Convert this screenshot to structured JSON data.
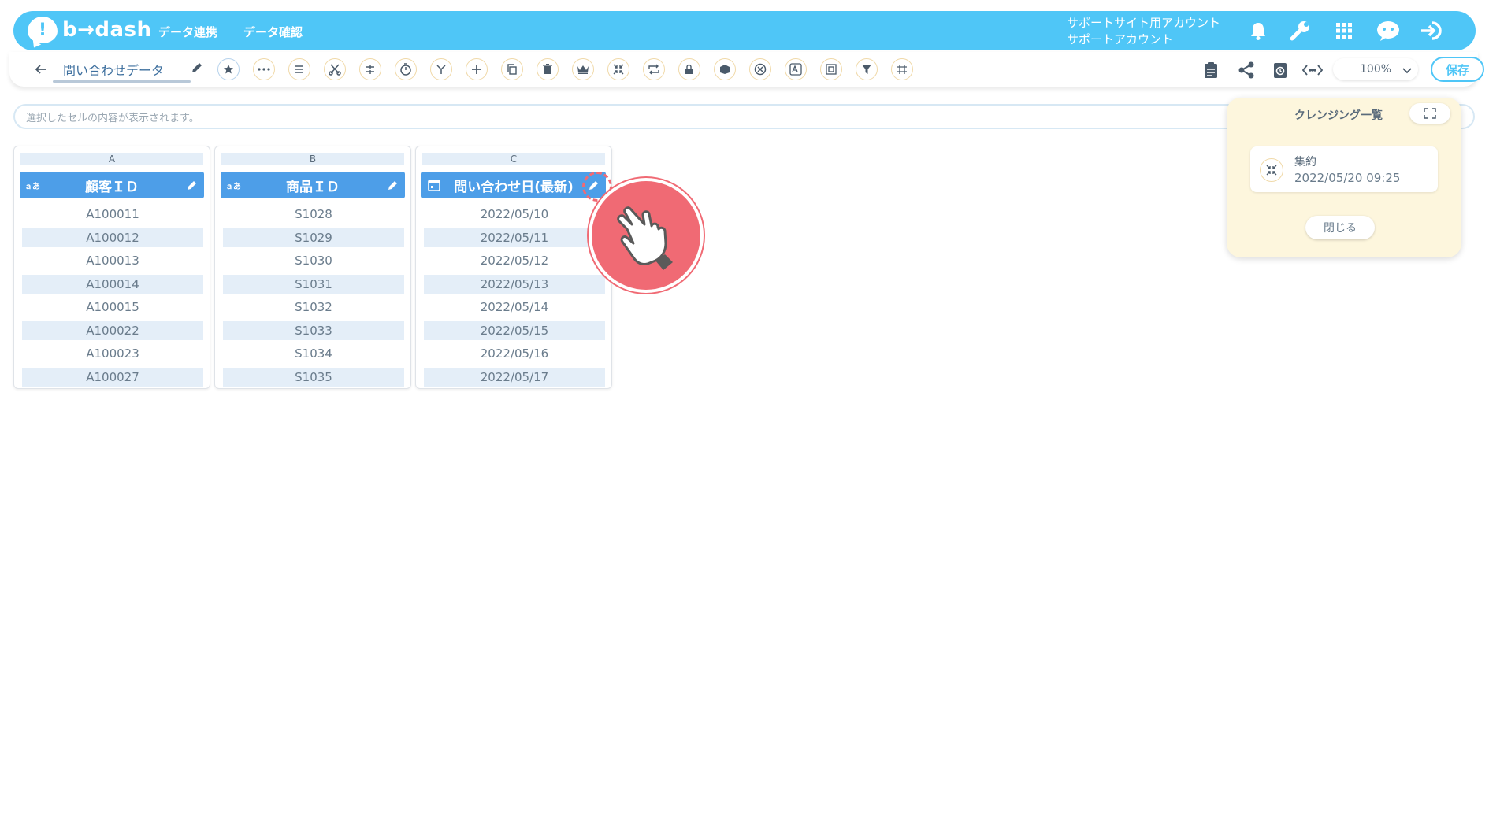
{
  "header": {
    "logo_text": "b→dash",
    "nav": [
      "データ連携",
      "データ確認"
    ],
    "account_line1": "サポートサイト用アカウント",
    "account_line2": "サポートアカウント",
    "icons": [
      "bell-icon",
      "wrench-icon",
      "apps-grid-icon",
      "chat-bot-icon",
      "logout-icon"
    ]
  },
  "toolbar": {
    "title": "問い合わせデータ",
    "zoom": "100%",
    "save_label": "保存",
    "tools": [
      "star-icon",
      "dots-icon",
      "list-icon",
      "scissors-icon",
      "sort-icon",
      "timer-icon",
      "branch-icon",
      "plus-icon",
      "copy-icon",
      "trash-icon",
      "crown-icon",
      "collapse-icon",
      "repeat-icon",
      "lock-icon",
      "box-icon",
      "cancel-icon",
      "translate-icon",
      "frame-icon",
      "filter-icon",
      "grid-icon"
    ],
    "right_tools": [
      "clipboard-icon",
      "share-icon",
      "history-icon",
      "code-icon"
    ]
  },
  "cellbar": {
    "placeholder": "選択したセルの内容が表示されます。"
  },
  "columns": [
    {
      "letter": "A",
      "name": "顧客ＩＤ",
      "type": "あ",
      "cells": [
        "A100011",
        "A100012",
        "A100013",
        "A100014",
        "A100015",
        "A100022",
        "A100023",
        "A100027"
      ]
    },
    {
      "letter": "B",
      "name": "商品ＩＤ",
      "type": "あ",
      "cells": [
        "S1028",
        "S1029",
        "S1030",
        "S1031",
        "S1032",
        "S1033",
        "S1034",
        "S1035"
      ]
    },
    {
      "letter": "C",
      "name": "問い合わせ日(最新)",
      "type": "calendar",
      "cells": [
        "2022/05/10",
        "2022/05/11",
        "2022/05/12",
        "2022/05/13",
        "2022/05/14",
        "2022/05/15",
        "2022/05/16",
        "2022/05/17"
      ]
    }
  ],
  "panel": {
    "title": "クレンジング一覧",
    "item_name": "集約",
    "item_date": "2022/05/20 09:25",
    "close_label": "閉じる"
  },
  "colors": {
    "header": "#4fc6f7",
    "column_header": "#4d9ee8",
    "highlight": "#f06a74",
    "panel_bg": "#fdf6dd"
  }
}
